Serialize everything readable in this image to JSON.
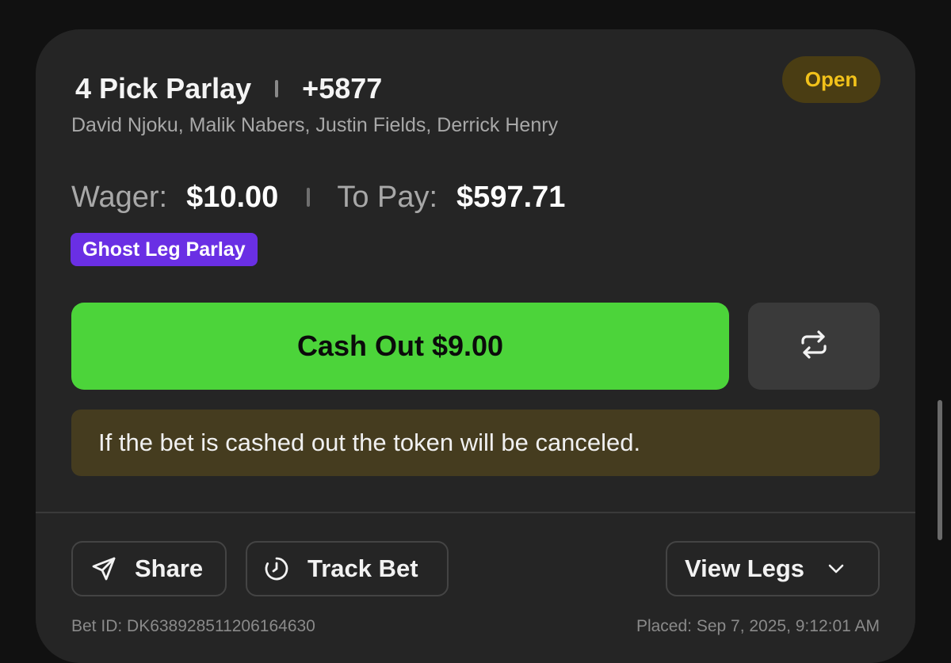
{
  "bet": {
    "title": "4 Pick Parlay",
    "odds": "+5877",
    "legs_summary": "David Njoku, Malik Nabers, Justin Fields, Derrick Henry",
    "status": "Open",
    "wager_label": "Wager:",
    "wager_value": "$10.00",
    "to_pay_label": "To Pay:",
    "to_pay_value": "$597.71",
    "badge": "Ghost Leg Parlay"
  },
  "cashout": {
    "label": "Cash Out $9.00",
    "notice": "If the bet is cashed out the token will be canceled."
  },
  "actions": {
    "share": "Share",
    "track": "Track Bet",
    "view_legs": "View Legs"
  },
  "footer": {
    "bet_id": "Bet ID: DK638928511206164630",
    "placed": "Placed: Sep 7, 2025, 9:12:01 AM"
  },
  "icons": [
    "send-icon",
    "swap-icon",
    "clock-icon",
    "chevron-down-icon"
  ],
  "colors": {
    "cashout_green": "#4cd43a",
    "ghost_purple": "#6a2fe4",
    "open_yellow": "#f2c21a"
  }
}
